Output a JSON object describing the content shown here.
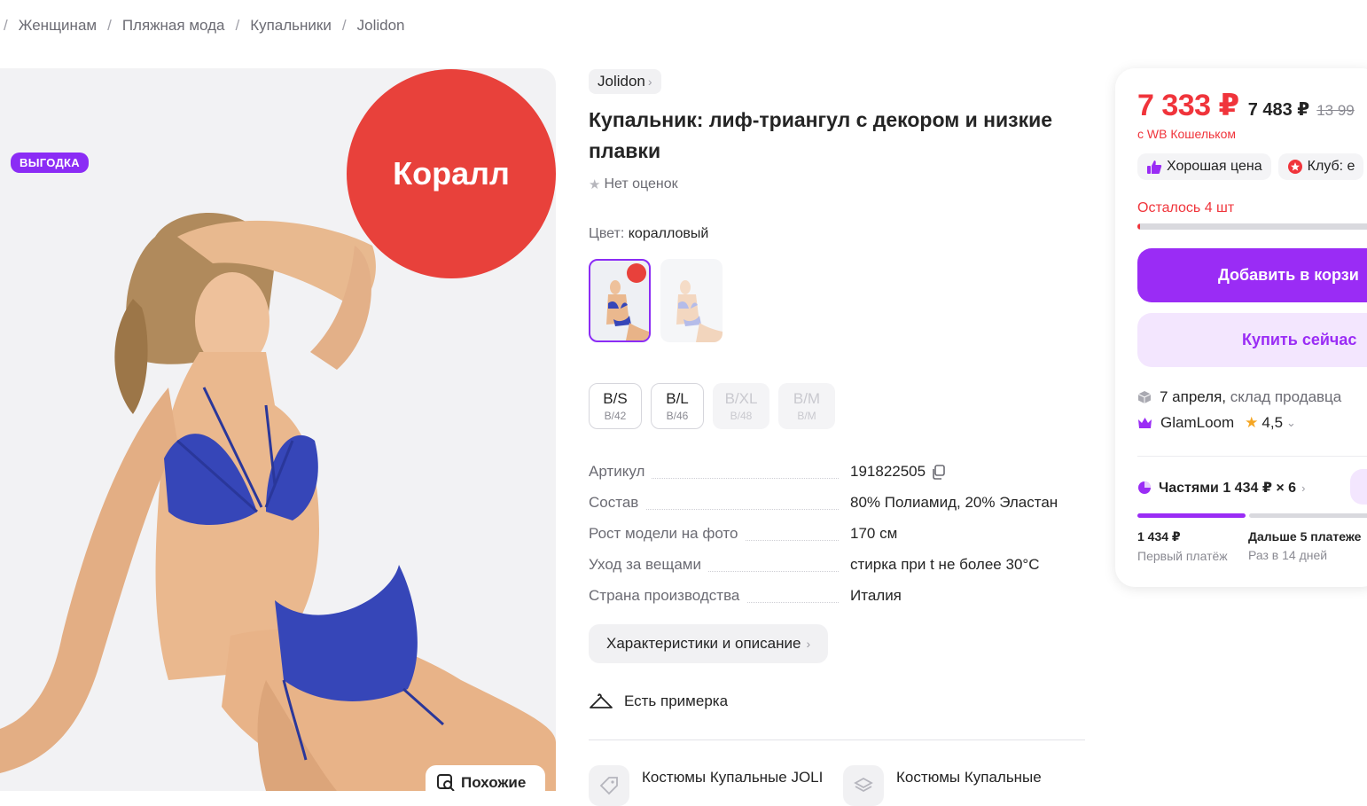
{
  "breadcrumb": [
    "Женщинам",
    "Пляжная мода",
    "Купальники",
    "Jolidon"
  ],
  "gallery": {
    "badge": "ВЫГОДКА",
    "color_circle": "Коралл",
    "similar_label": "Похожие"
  },
  "product": {
    "brand": "Jolidon",
    "title": "Купальник: лиф-триангул с декором и низкие плавки",
    "rating_text": "Нет оценок",
    "color_label": "Цвет:",
    "color_value": "коралловый",
    "sizes": [
      {
        "label": "B/S",
        "sub": "B/42",
        "available": true
      },
      {
        "label": "B/L",
        "sub": "B/46",
        "available": true
      },
      {
        "label": "B/XL",
        "sub": "B/48",
        "available": false
      },
      {
        "label": "B/M",
        "sub": "B/M",
        "available": false
      }
    ],
    "specs": [
      {
        "key": "Артикул",
        "value": "191822505"
      },
      {
        "key": "Состав",
        "value": "80% Полиамид, 20% Эластан"
      },
      {
        "key": "Рост модели на фото",
        "value": "170 см"
      },
      {
        "key": "Уход за вещами",
        "value": "стирка при t не более 30°С"
      },
      {
        "key": "Страна производства",
        "value": "Италия"
      }
    ],
    "chars_button": "Характеристики и описание",
    "fitting": "Есть примерка",
    "collections": [
      "Костюмы Купальные JOLI",
      "Костюмы Купальные"
    ]
  },
  "buy_card": {
    "price": "7 333 ₽",
    "price_old": "7 483 ₽",
    "price_strike": "13 99",
    "wallet_note": "с WB Кошельком",
    "chip_good_price": "Хорошая цена",
    "chip_club": "Клуб: е",
    "stock_text": "Осталось 4 шт",
    "stock_level": 0.01,
    "add_to_cart": "Добавить в корзи",
    "buy_now": "Купить сейчас",
    "delivery_date": "7 апреля,",
    "delivery_from": "склад продавца",
    "seller_name": "GlamLoom",
    "seller_rating": "4,5",
    "installments": "Частями 1 434 ₽ × 6",
    "first_payment_amount": "1 434 ₽",
    "first_payment_label": "Первый платёж",
    "next_payments_amount": "Дальше 5 платеже",
    "next_payments_label": "Раз в 14 дней"
  },
  "colors": {
    "accent_purple": "#9a2cf5",
    "price_red": "#f0343b",
    "coral": "#e8413b",
    "swimsuit_blue": "#3646b8"
  }
}
